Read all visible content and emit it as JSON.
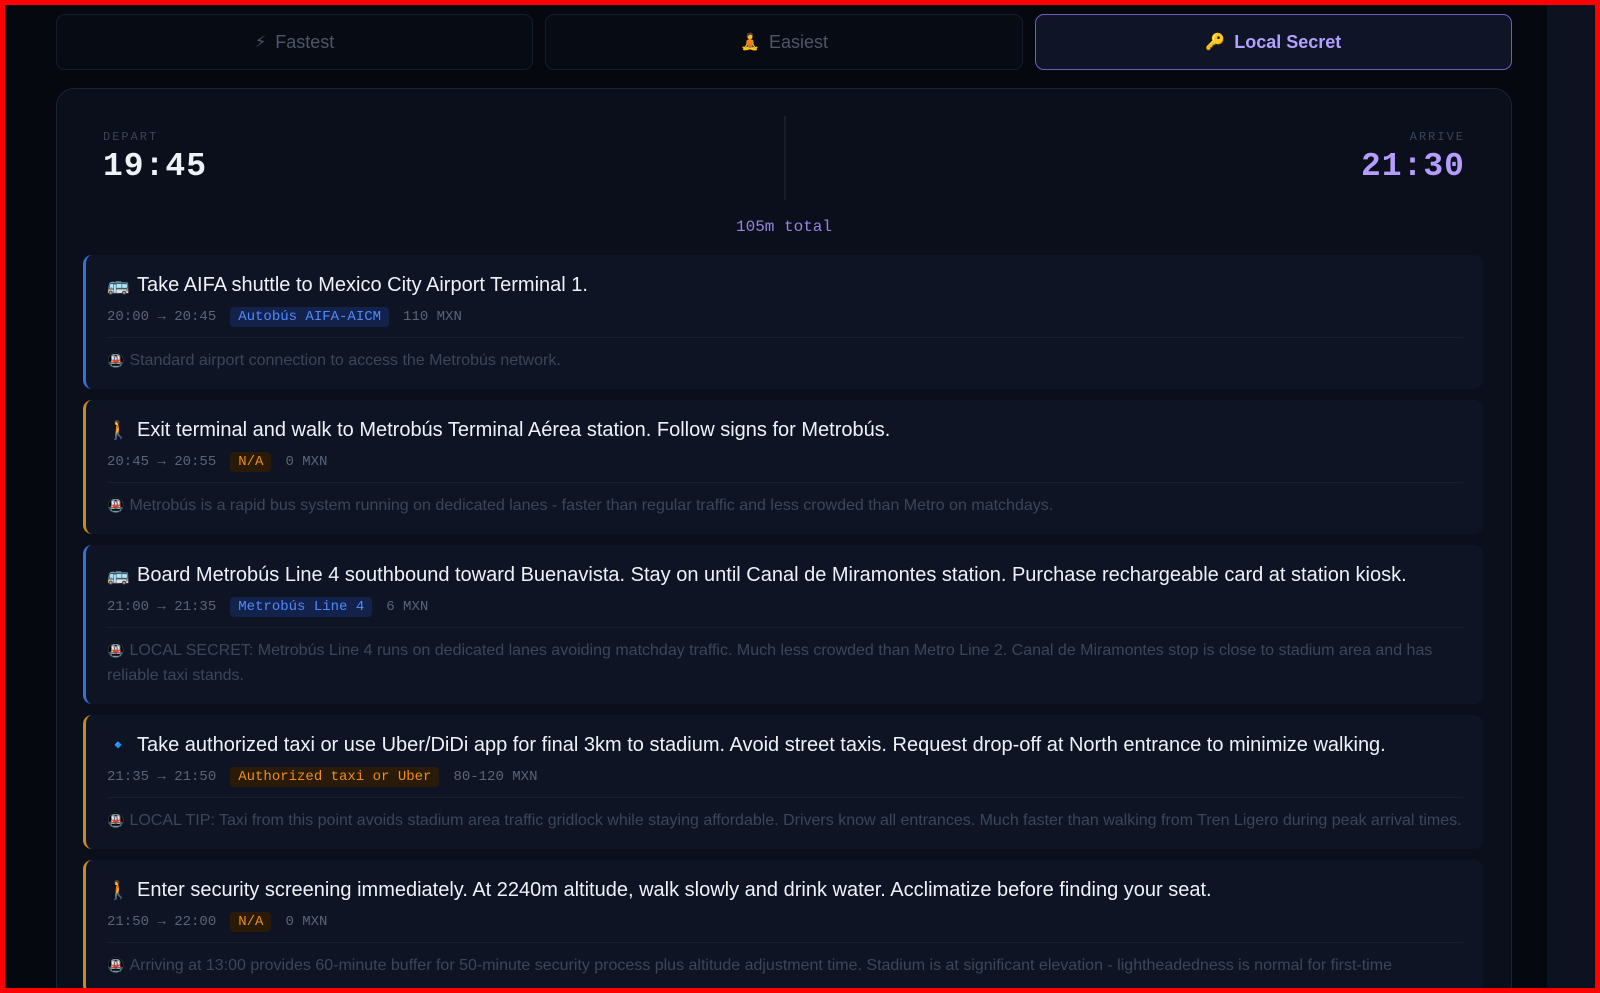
{
  "tabs": [
    {
      "icon": "⚡",
      "label": "Fastest",
      "active": false
    },
    {
      "icon": "🧘",
      "label": "Easiest",
      "active": false
    },
    {
      "icon": "🔑",
      "label": "Local Secret",
      "active": true
    }
  ],
  "route": {
    "depart_label": "DEPART",
    "depart_time": "19:45",
    "arrive_label": "ARRIVE",
    "arrive_time": "21:30",
    "total": "105m total"
  },
  "steps": [
    {
      "icon": "🚌",
      "icon_name": "bus-icon",
      "title": "Take AIFA shuttle to Mexico City Airport Terminal 1.",
      "times": "20:00 → 20:45",
      "service": "Autobús AIFA-AICM",
      "service_color": "#4f89ff",
      "cost": "110 MXN",
      "note_icon": "🚇",
      "note": "Standard airport connection to access the Metrobús network."
    },
    {
      "icon": "🚶",
      "icon_name": "walk-icon",
      "title": "Exit terminal and walk to Metrobús Terminal Aérea station. Follow signs for Metrobús.",
      "times": "20:45 → 20:55",
      "service": "N/A",
      "service_color": "#ee8d1a",
      "cost": "0 MXN",
      "note_icon": "🚇",
      "note": "Metrobús is a rapid bus system running on dedicated lanes - faster than regular traffic and less crowded than Metro on matchdays."
    },
    {
      "icon": "🚌",
      "icon_name": "bus-icon",
      "title": "Board Metrobús Line 4 southbound toward Buenavista. Stay on until Canal de Miramontes station. Purchase rechargeable card at station kiosk.",
      "times": "21:00 → 21:35",
      "service": "Metrobús Line 4",
      "service_color": "#4f89ff",
      "cost": "6 MXN",
      "note_icon": "🚇",
      "note": "LOCAL SECRET: Metrobús Line 4 runs on dedicated lanes avoiding matchday traffic. Much less crowded than Metro Line 2. Canal de Miramontes stop is close to stadium area and has reliable taxi stands."
    },
    {
      "icon": "🔹",
      "icon_name": "diamond-icon",
      "title": "Take authorized taxi or use Uber/DiDi app for final 3km to stadium. Avoid street taxis. Request drop-off at North entrance to minimize walking.",
      "times": "21:35 → 21:50",
      "service": "Authorized taxi or Uber",
      "service_color": "#ee8d1a",
      "cost": "80-120 MXN",
      "note_icon": "🚇",
      "note": "LOCAL TIP: Taxi from this point avoids stadium area traffic gridlock while staying affordable. Drivers know all entrances. Much faster than walking from Tren Ligero during peak arrival times."
    },
    {
      "icon": "🚶",
      "icon_name": "walk-icon",
      "title": "Enter security screening immediately. At 2240m altitude, walk slowly and drink water. Acclimatize before finding your seat.",
      "times": "21:50 → 22:00",
      "service": "N/A",
      "service_color": "#ee8d1a",
      "cost": "0 MXN",
      "note_icon": "🚇",
      "note": "Arriving at 13:00 provides 60-minute buffer for 50-minute security process plus altitude adjustment time. Stadium is at significant elevation - lightheadedness is normal for first-time"
    }
  ]
}
